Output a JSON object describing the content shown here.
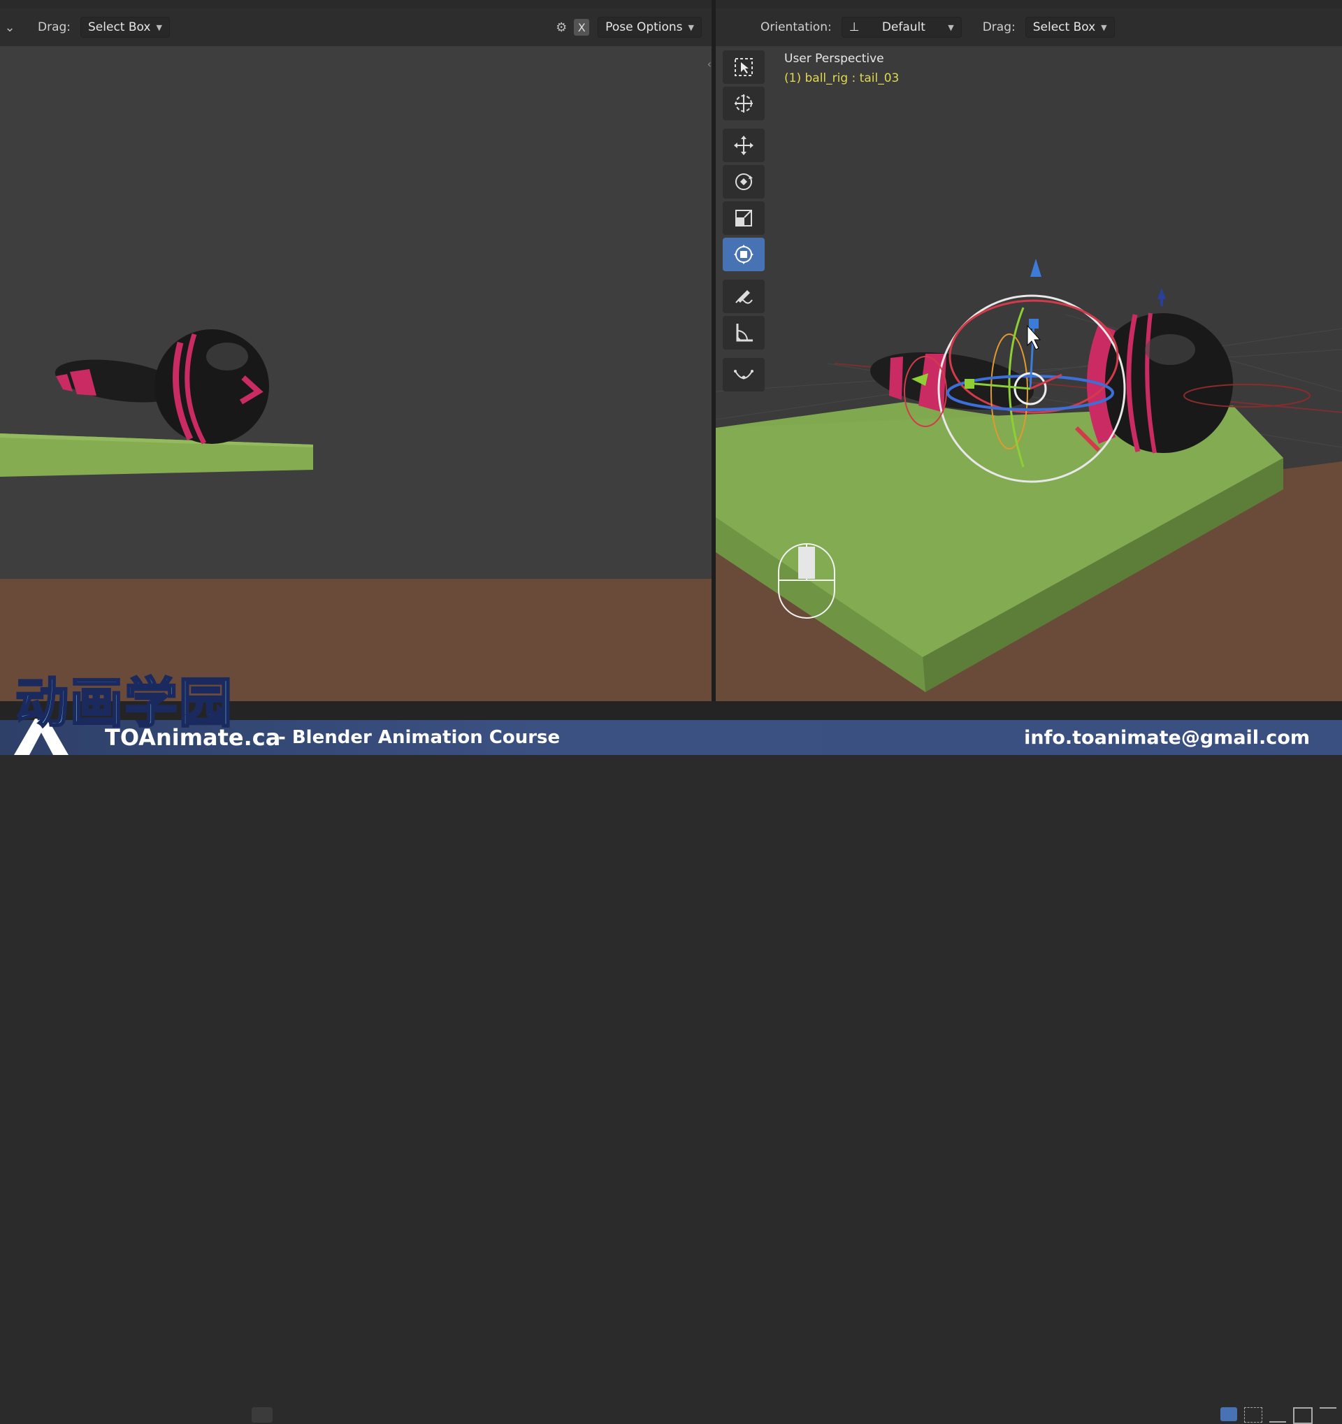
{
  "left_view": {
    "drag_label": "Drag:",
    "drag_value": "Select Box",
    "close_label": "X",
    "pose_options_label": "Pose Options"
  },
  "right_view": {
    "orientation_label": "Orientation:",
    "orientation_value": "Default",
    "drag_label": "Drag:",
    "drag_value": "Select Box",
    "view_name": "User Perspective",
    "active_object": "(1) ball_rig : tail_03"
  },
  "tools": [
    {
      "name": "select-box-tool"
    },
    {
      "name": "cursor-tool"
    },
    {
      "name": "move-tool"
    },
    {
      "name": "rotate-tool"
    },
    {
      "name": "scale-tool"
    },
    {
      "name": "transform-tool",
      "active": true
    },
    {
      "name": "annotate-tool"
    },
    {
      "name": "measure-tool"
    },
    {
      "name": "curve-tool"
    }
  ],
  "branding": {
    "logo_text": "动画学园",
    "site": "TOAnimate.ca",
    "course": "- Blender Animation Course",
    "email": "info.toanimate@gmail.com"
  },
  "colors": {
    "accent_blue": "#4772b3",
    "text_yellow": "#e0d850",
    "ground_green": "#7fa84f",
    "floor_brown": "#6a4a38",
    "ball_pink": "#d2306a",
    "banner_blue": "#3b5182"
  }
}
